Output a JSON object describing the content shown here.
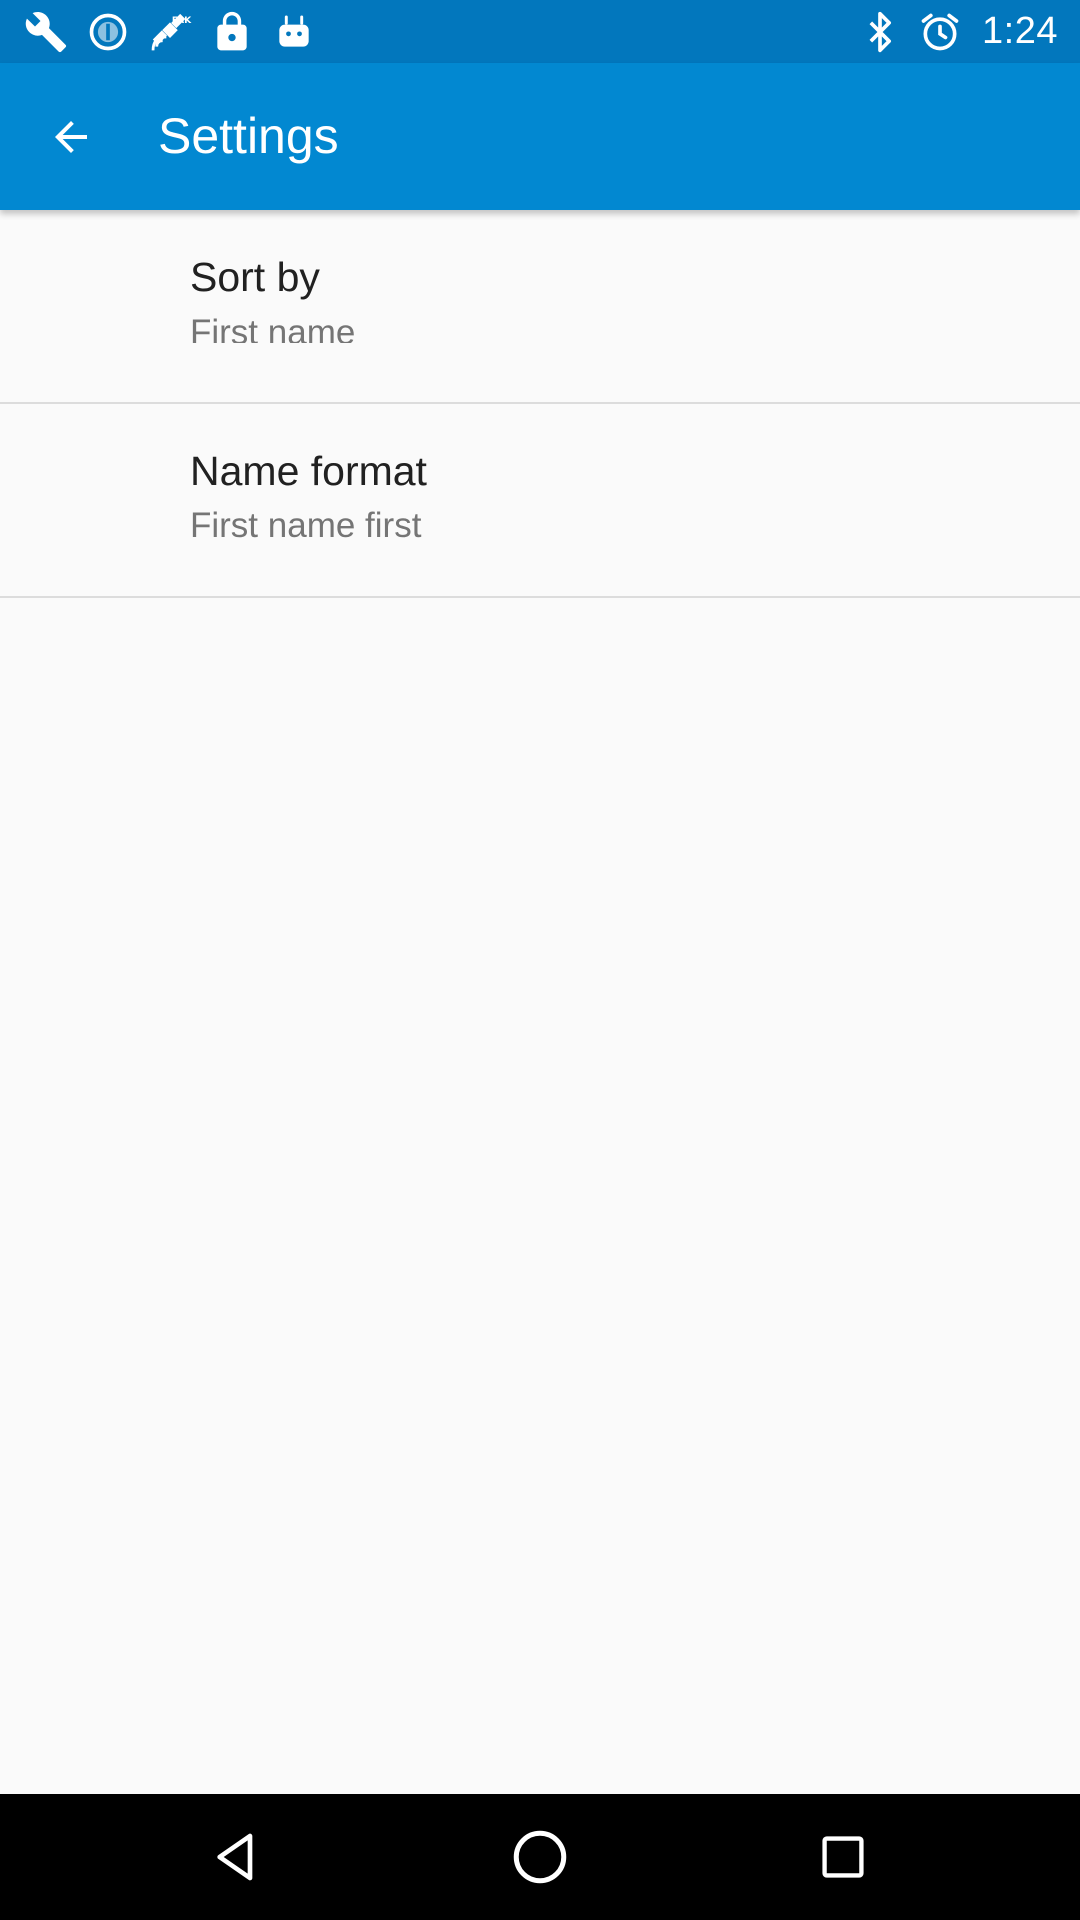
{
  "status_bar": {
    "time": "1:24",
    "left_icons": [
      "wrench-icon",
      "info-circle-icon",
      "fake-gps-satellite-icon",
      "lock-icon",
      "android-icon"
    ],
    "right_icons": [
      "bluetooth-icon",
      "alarm-clock-icon"
    ]
  },
  "app_bar": {
    "title": "Settings",
    "background_color": "#0288d1",
    "status_color": "#0277bd"
  },
  "preferences": [
    {
      "title": "Sort by",
      "summary": "First name"
    },
    {
      "title": "Name format",
      "summary": "First name first"
    }
  ],
  "nav_bar": {
    "buttons": [
      "back-triangle-icon",
      "home-circle-icon",
      "recents-square-icon"
    ]
  }
}
